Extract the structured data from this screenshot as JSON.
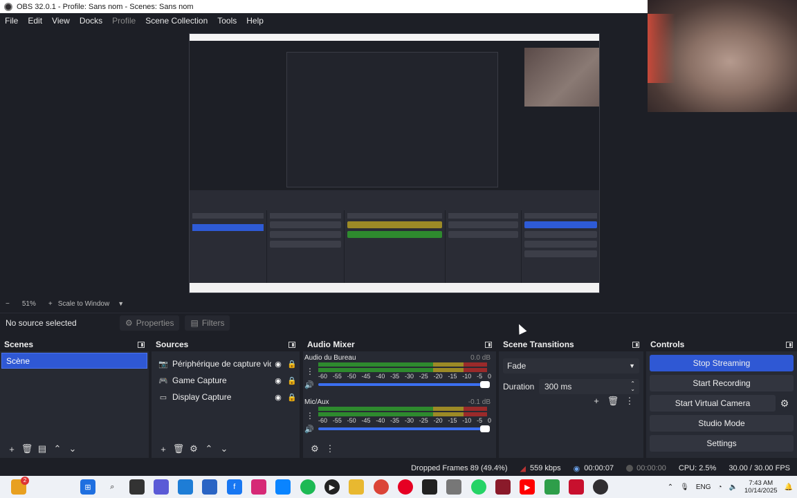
{
  "window": {
    "title": "OBS 32.0.1 - Profile: Sans nom - Scenes: Sans nom"
  },
  "menu": [
    "File",
    "Edit",
    "View",
    "Docks",
    "Profile",
    "Scene Collection",
    "Tools",
    "Help"
  ],
  "zoom": {
    "minus": "−",
    "level": "51%",
    "plus": "+",
    "mode": "Scale to Window"
  },
  "context": {
    "no_source": "No source selected",
    "properties": "Properties",
    "filters": "Filters"
  },
  "scenes": {
    "title": "Scenes",
    "items": [
      "Scène"
    ]
  },
  "sources": {
    "title": "Sources",
    "items": [
      {
        "name": "Périphérique de capture vidéo",
        "icon": "camera-icon"
      },
      {
        "name": "Game Capture",
        "icon": "gamepad-icon"
      },
      {
        "name": "Display Capture",
        "icon": "monitor-icon"
      }
    ]
  },
  "mixer": {
    "title": "Audio Mixer",
    "ticks": [
      "-60",
      "-55",
      "-50",
      "-45",
      "-40",
      "-35",
      "-30",
      "-25",
      "-20",
      "-15",
      "-10",
      "-5",
      "0"
    ],
    "channels": [
      {
        "name": "Audio du Bureau",
        "db": "0.0 dB",
        "volume": 1.0
      },
      {
        "name": "Mic/Aux",
        "db": "-0.1 dB",
        "volume": 0.99
      }
    ]
  },
  "transitions": {
    "title": "Scene Transitions",
    "selected": "Fade",
    "duration_label": "Duration",
    "duration_value": "300 ms"
  },
  "controls": {
    "title": "Controls",
    "stop_streaming": "Stop Streaming",
    "start_recording": "Start Recording",
    "start_virtual_camera": "Start Virtual Camera",
    "studio_mode": "Studio Mode",
    "settings": "Settings"
  },
  "status": {
    "dropped_frames": "Dropped Frames 89 (49.4%)",
    "bitrate": "559 kbps",
    "stream_time": "00:00:07",
    "record_time": "00:00:00",
    "cpu": "CPU: 2.5%",
    "fps": "30.00 / 30.00 FPS"
  },
  "taskbar": {
    "lang": "ENG",
    "time": "7:43 AM",
    "date": "10/14/2025",
    "badge": "2"
  },
  "colors": {
    "accent": "#2f58d4",
    "bg": "#1d1f26",
    "dock": "#272a33"
  }
}
